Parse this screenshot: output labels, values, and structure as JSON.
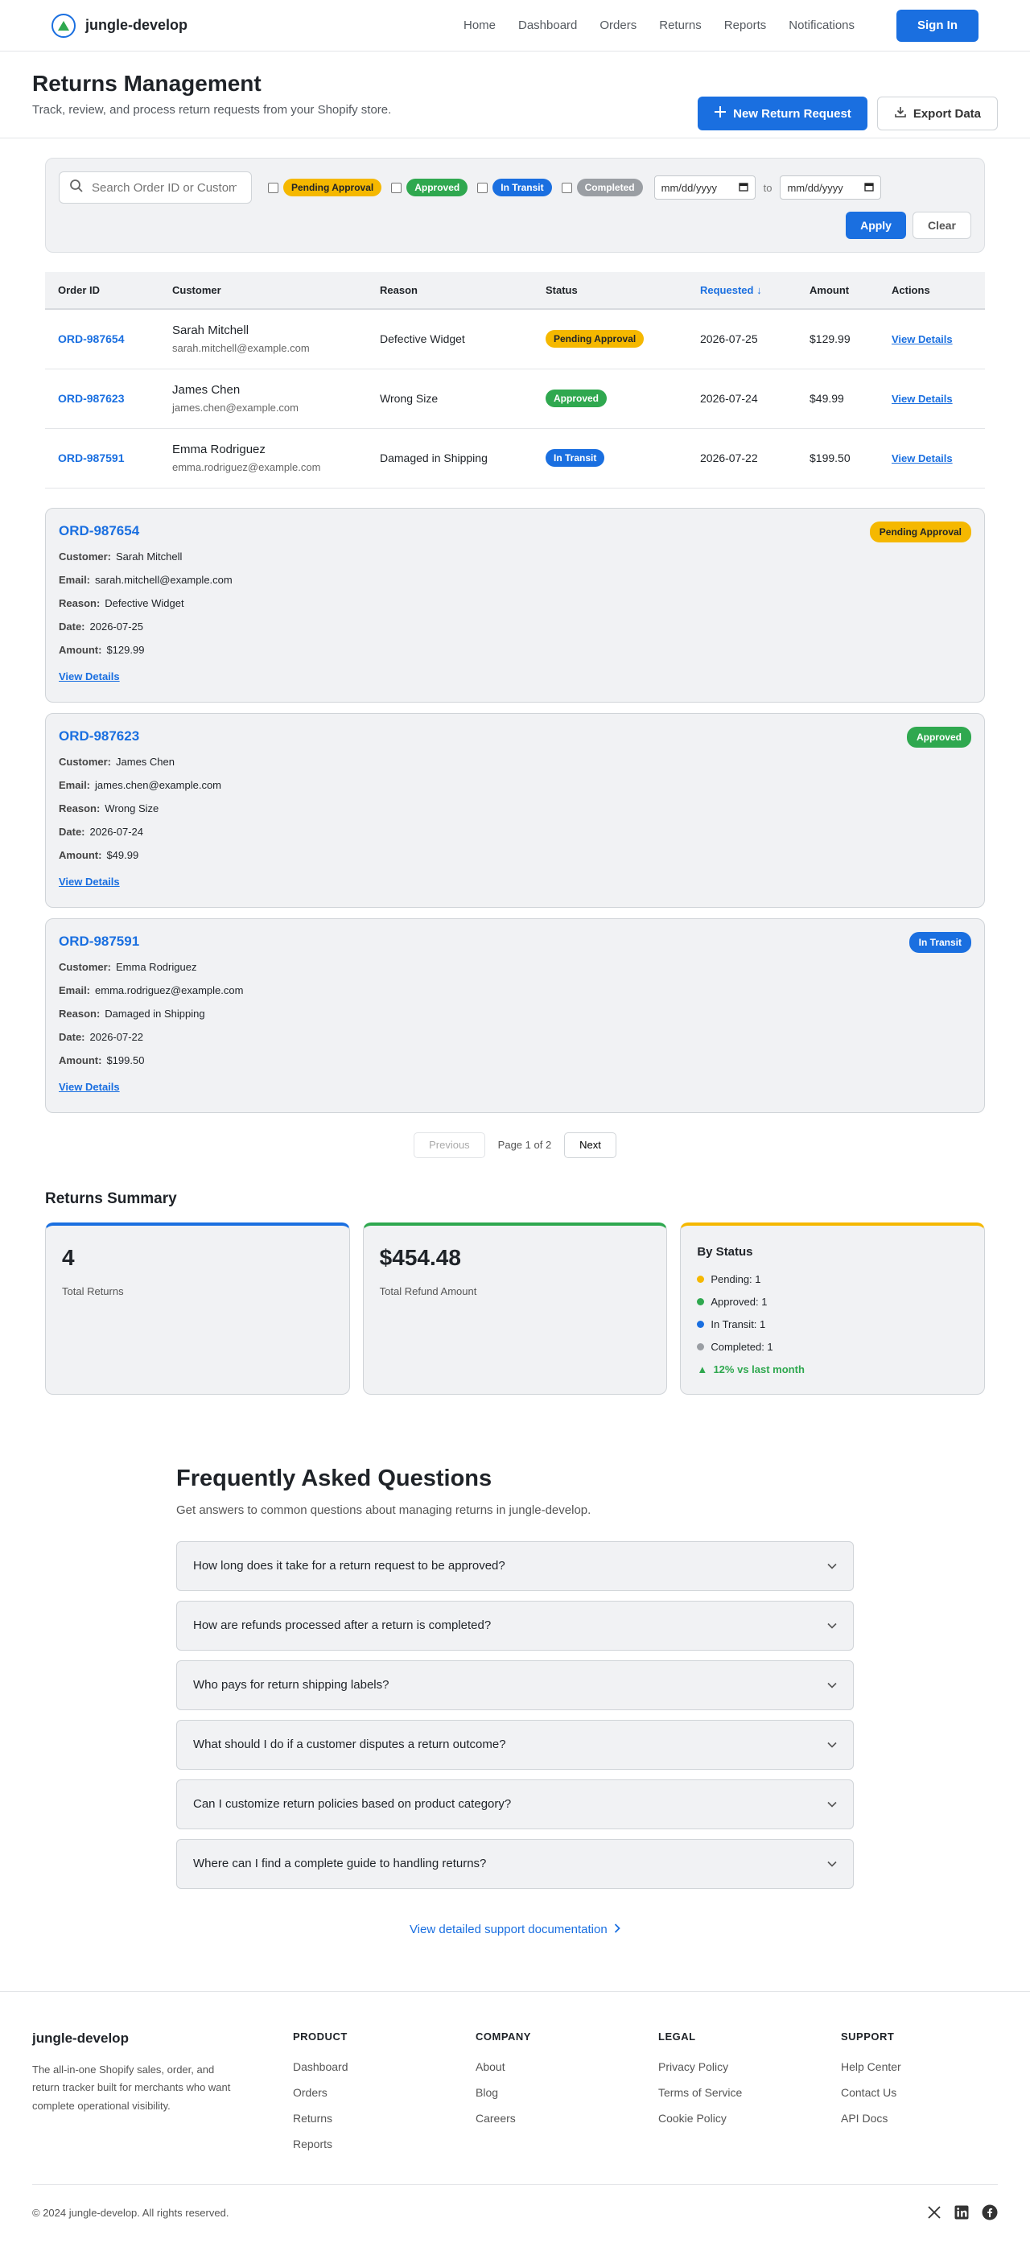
{
  "nav": {
    "brand": "jungle-develop",
    "links": [
      "Home",
      "Dashboard",
      "Orders",
      "Returns",
      "Reports",
      "Notifications"
    ],
    "signin": "Sign In"
  },
  "header": {
    "title": "Returns Management",
    "subtitle": "Track, review, and process return requests from your Shopify store.",
    "new_button": "New Return Request",
    "export_button": "Export Data"
  },
  "filters": {
    "search_placeholder": "Search Order ID or Customer",
    "statuses": [
      "Pending Approval",
      "Approved",
      "In Transit",
      "Completed"
    ],
    "date_from": "mm/dd/yyyy",
    "date_to": "mm/dd/yyyy",
    "to_label": "to",
    "apply": "Apply",
    "clear": "Clear"
  },
  "table": {
    "headers": [
      "Order ID",
      "Customer",
      "Reason",
      "Status",
      "Requested ↓",
      "Amount",
      "Actions"
    ],
    "rows": [
      {
        "id": "ORD-987654",
        "name": "Sarah Mitchell",
        "email": "sarah.mitchell@example.com",
        "reason": "Defective Widget",
        "status": "Pending Approval",
        "date": "2026-07-25",
        "amount": "$129.99",
        "action": "View Details"
      },
      {
        "id": "ORD-987623",
        "name": "James Chen",
        "email": "james.chen@example.com",
        "reason": "Wrong Size",
        "status": "Approved",
        "date": "2026-07-24",
        "amount": "$49.99",
        "action": "View Details"
      },
      {
        "id": "ORD-987591",
        "name": "Emma Rodriguez",
        "email": "emma.rodriguez@example.com",
        "reason": "Damaged in Shipping",
        "status": "In Transit",
        "date": "2026-07-22",
        "amount": "$199.50",
        "action": "View Details"
      }
    ]
  },
  "card_labels": {
    "customer": "Customer:",
    "email": "Email:",
    "reason": "Reason:",
    "date": "Date:",
    "amount": "Amount:"
  },
  "pagination": {
    "previous": "Previous",
    "info": "Page 1 of 2",
    "next": "Next"
  },
  "summary": {
    "title": "Returns Summary",
    "total_returns": "4",
    "total_returns_label": "Total Returns",
    "refund_amount": "$454.48",
    "refund_label": "Total Refund Amount",
    "by_status_title": "By Status",
    "by_status": [
      "Pending: 1",
      "Approved: 1",
      "In Transit: 1",
      "Completed: 1"
    ],
    "trend": "12% vs last month"
  },
  "faq": {
    "title": "Frequently Asked Questions",
    "subtitle": "Get answers to common questions about managing returns in jungle-develop.",
    "items": [
      "How long does it take for a return request to be approved?",
      "How are refunds processed after a return is completed?",
      "Who pays for return shipping labels?",
      "What should I do if a customer disputes a return outcome?",
      "Can I customize return policies based on product category?",
      "Where can I find a complete guide to handling returns?"
    ],
    "support_link": "View detailed support documentation"
  },
  "footer": {
    "brand": "jungle-develop",
    "description": "The all-in-one Shopify sales, order, and return tracker built for merchants who want complete operational visibility.",
    "columns": [
      {
        "head": "PRODUCT",
        "links": [
          "Dashboard",
          "Orders",
          "Returns",
          "Reports"
        ]
      },
      {
        "head": "COMPANY",
        "links": [
          "About",
          "Blog",
          "Careers"
        ]
      },
      {
        "head": "LEGAL",
        "links": [
          "Privacy Policy",
          "Terms of Service",
          "Cookie Policy"
        ]
      },
      {
        "head": "SUPPORT",
        "links": [
          "Help Center",
          "Contact Us",
          "API Docs"
        ]
      }
    ],
    "copyright": "© 2024 jungle-develop. All rights reserved.",
    "socials": [
      "x-icon",
      "linkedin-icon",
      "facebook-icon"
    ]
  },
  "colors": {
    "primary": "#1a6fe0",
    "pending": "#f5b800",
    "approved": "#2fa84f",
    "transit": "#1a6fe0",
    "completed": "#9a9ea3"
  }
}
